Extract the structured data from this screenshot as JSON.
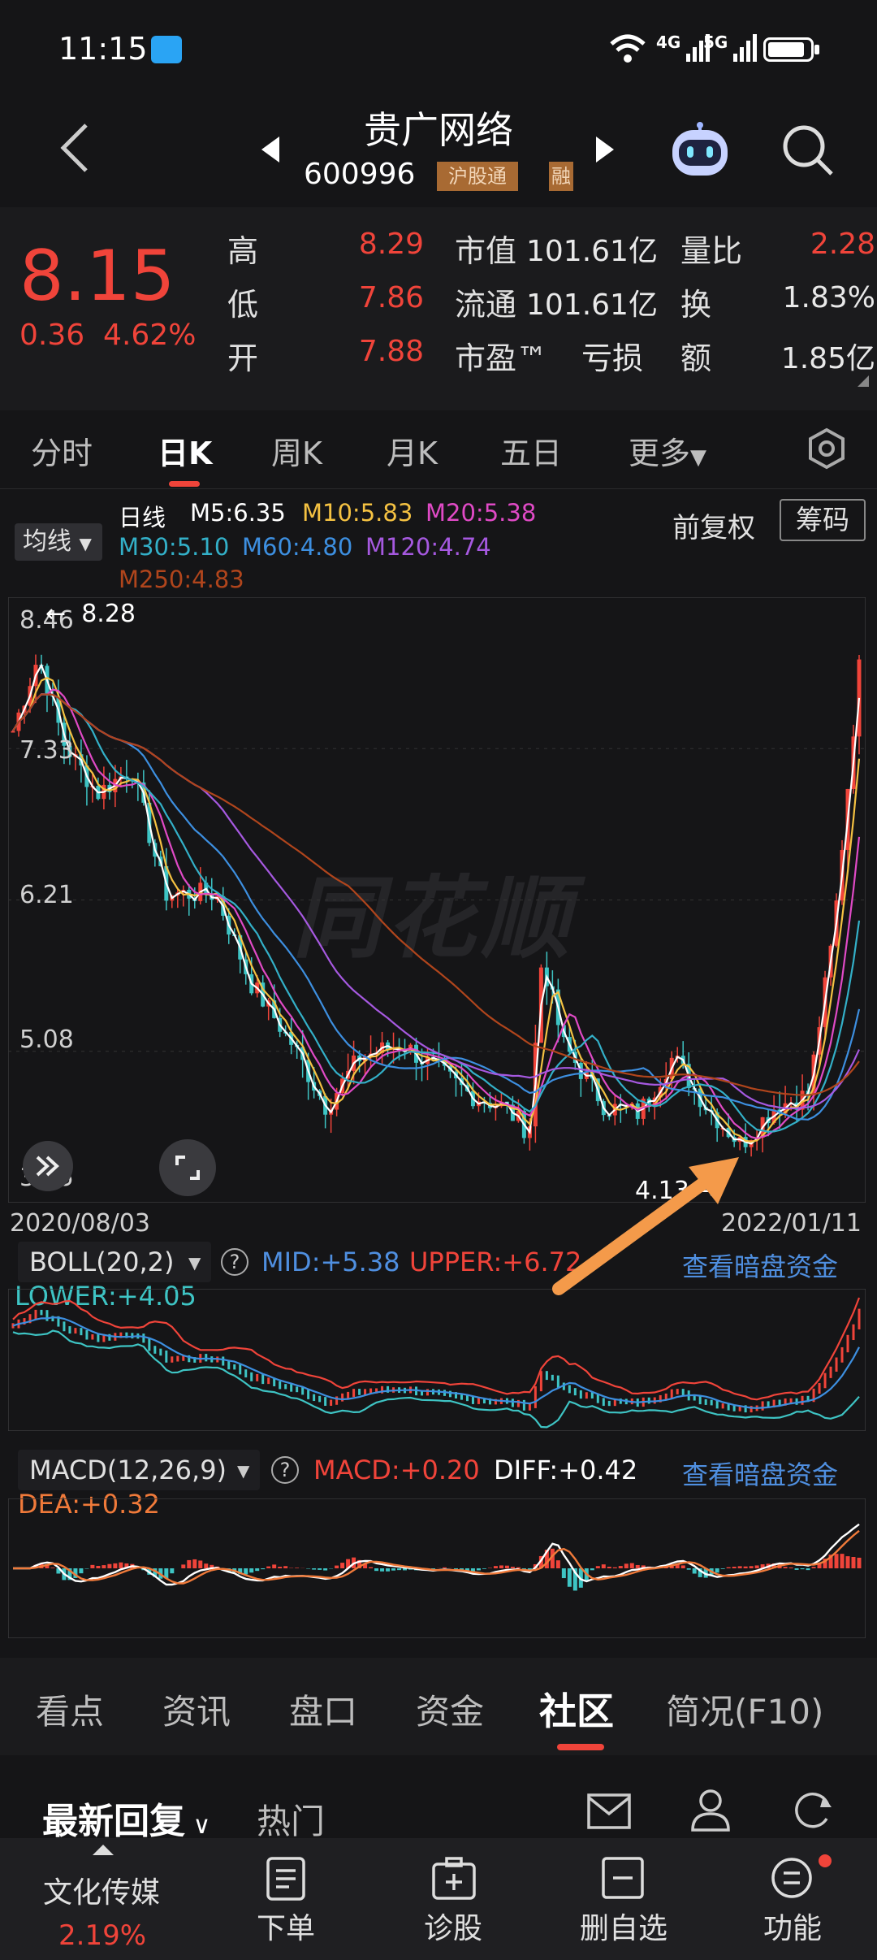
{
  "status_bar": {
    "time": "11:15",
    "net1": "4G",
    "net2": "5G"
  },
  "header": {
    "stock_name": "贵广网络",
    "stock_code": "600996",
    "tag_hgt": "沪股通",
    "tag_rong": "融"
  },
  "quote": {
    "price": "8.15",
    "change": "0.36",
    "change_pct": "4.62%",
    "high_label": "高",
    "high": "8.29",
    "low_label": "低",
    "low": "7.86",
    "open_label": "开",
    "open": "7.88",
    "mktcap_label": "市值",
    "mktcap": "101.61亿",
    "float_label": "流通",
    "float": "101.61亿",
    "pe_label": "市盈™",
    "pe": "亏损",
    "volratio_label": "量比",
    "volratio": "2.28",
    "turnover_label": "换",
    "turnover": "1.83%",
    "amount_label": "额",
    "amount": "1.85亿"
  },
  "period_tabs": [
    "分时",
    "日K",
    "周K",
    "月K",
    "五日",
    "更多"
  ],
  "ma_legend": {
    "dropdown": "均线",
    "title": "日线",
    "m5": "M5:6.35",
    "m10": "M10:5.83",
    "m20": "M20:5.38",
    "m30": "M30:5.10",
    "m60": "M60:4.80",
    "m120": "M120:4.74",
    "m250": "M250:4.83",
    "adj": "前复权",
    "chip": "筹码"
  },
  "colors": {
    "red": "#f0443a",
    "green": "#3ec4c4",
    "m5": "#ffffff",
    "m10": "#f5c242",
    "m20": "#e04ac6",
    "m30": "#33b0c8",
    "m60": "#3d8fe0",
    "m120": "#a659e0",
    "m250": "#b0451c"
  },
  "chart_data": {
    "type": "candlestick",
    "y_ticks": [
      "8.46",
      "7.33",
      "6.21",
      "5.08",
      "3.95"
    ],
    "x_start": "2020/08/03",
    "x_end": "2022/01/11",
    "max_marker": "8.28",
    "min_marker": "4.13",
    "watermark": "同花顺"
  },
  "boll": {
    "label": "BOLL(20,2)",
    "mid": "MID:+5.38",
    "upper": "UPPER:+6.72",
    "lower": "LOWER:+4.05",
    "link": "查看暗盘资金"
  },
  "macd": {
    "label": "MACD(12,26,9)",
    "macd": "MACD:+0.20",
    "diff": "DIFF:+0.42",
    "dea": "DEA:+0.32",
    "link": "查看暗盘资金"
  },
  "section_tabs": [
    "看点",
    "资讯",
    "盘口",
    "资金",
    "社区",
    "简况(F10)"
  ],
  "reply_bar": {
    "latest": "最新回复",
    "hot": "热门"
  },
  "bottom_nav": {
    "sector": "文化传媒",
    "sector_pct": "2.19%",
    "order": "下单",
    "diagnose": "诊股",
    "remove": "删自选",
    "function": "功能"
  }
}
